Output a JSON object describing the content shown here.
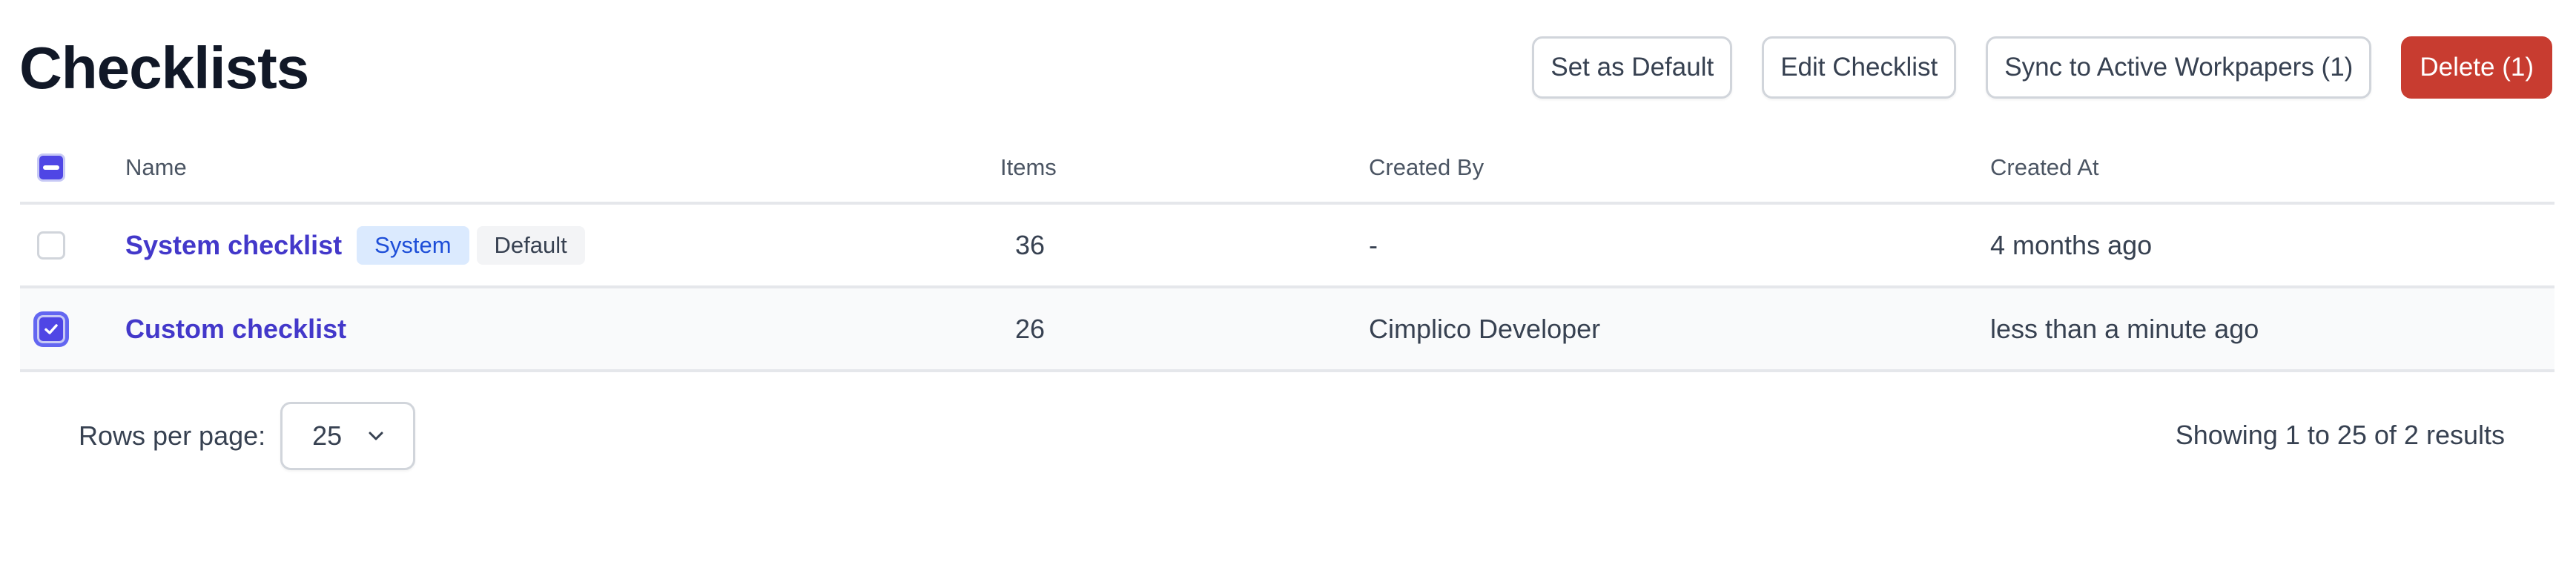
{
  "page": {
    "title": "Checklists"
  },
  "toolbar": {
    "set_default_label": "Set as Default",
    "edit_label": "Edit Checklist",
    "sync_label": "Sync to Active Workpapers (1)",
    "delete_label": "Delete (1)"
  },
  "table": {
    "headers": {
      "name": "Name",
      "items": "Items",
      "created_by": "Created By",
      "created_at": "Created At"
    },
    "select_all_state": "indeterminate",
    "rows": [
      {
        "name": "System checklist",
        "badges": [
          "System",
          "Default"
        ],
        "items": "36",
        "created_by": "-",
        "created_at": "4 months ago",
        "selected": false
      },
      {
        "name": "Custom checklist",
        "badges": [],
        "items": "26",
        "created_by": "Cimplico Developer",
        "created_at": "less than a minute ago",
        "selected": true
      }
    ]
  },
  "pagination": {
    "rows_per_page_label": "Rows per page:",
    "rows_per_page_value": "25",
    "summary": "Showing 1 to 25 of 2 results"
  },
  "colors": {
    "accent": "#4f46e5",
    "link": "#4338ca",
    "danger": "#c83c30"
  }
}
